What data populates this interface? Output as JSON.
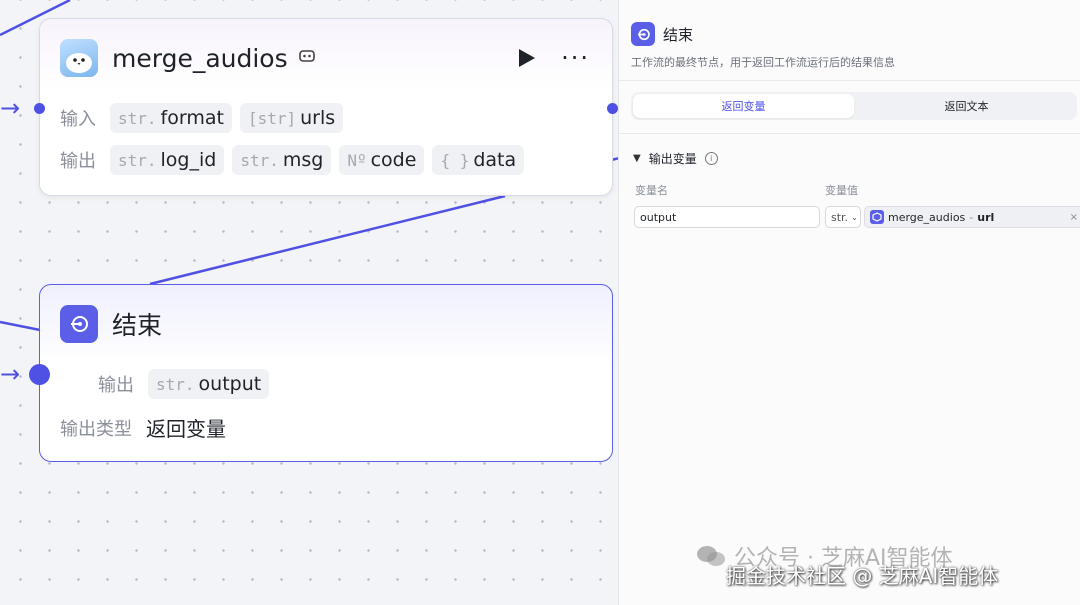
{
  "merge_node": {
    "title": "merge_audios",
    "inputs_label": "输入",
    "inputs": [
      {
        "type": "str.",
        "name": "format"
      },
      {
        "type": "[str]",
        "name": "urls"
      }
    ],
    "outputs_label": "输出",
    "outputs": [
      {
        "type": "str.",
        "name": "log_id"
      },
      {
        "type": "str.",
        "name": "msg"
      },
      {
        "type": "Nº",
        "name": "code"
      },
      {
        "type": "{ }",
        "name": "data"
      }
    ]
  },
  "end_node": {
    "title": "结束",
    "output_label": "输出",
    "output_type": "str.",
    "output_name": "output",
    "output_kind_label": "输出类型",
    "output_kind_value": "返回变量"
  },
  "panel": {
    "title": "结束",
    "description": "工作流的最终节点，用于返回工作流运行后的结果信息",
    "tabs": [
      "返回变量",
      "返回文本"
    ],
    "active_tab": 0,
    "section_title": "输出变量",
    "col_name": "变量名",
    "col_value": "变量值",
    "var_name": "output",
    "var_type": "str.",
    "ref_node": "merge_audios",
    "ref_sep": " - ",
    "ref_field": "url",
    "close_glyph": "×"
  },
  "watermark": {
    "line1": "公众号 · 芝麻AI智能体",
    "line2": "掘金技术社区 @ 芝麻AI智能体"
  },
  "colors": {
    "accent": "#4e51e3",
    "end_icon": "#5b5ee6"
  }
}
